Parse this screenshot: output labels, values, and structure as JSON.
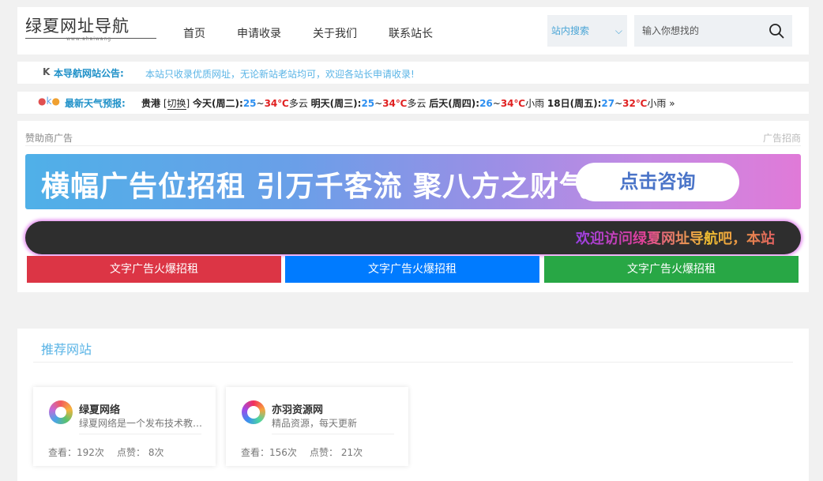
{
  "header": {
    "logo_text": "绿夏网址导航",
    "logo_sub": "www.ahaiwang",
    "nav": [
      "首页",
      "申请收录",
      "关于我们",
      "联系站长"
    ],
    "search_select": "站内搜索",
    "search_placeholder": "输入你想找的"
  },
  "notice": {
    "label": "本导航网站公告:",
    "text": "本站只收录优质网址，无论新站老站均可，欢迎各站长申请收录!"
  },
  "weather": {
    "label": "最新天气预报:",
    "city": "贵港",
    "switch": "切换",
    "days": [
      {
        "day": "今天(周二):",
        "lo": "25",
        "hi": "34℃",
        "cond": "多云"
      },
      {
        "day": "明天(周三):",
        "lo": "25",
        "hi": "34℃",
        "cond": "多云"
      },
      {
        "day": "后天(周四):",
        "lo": "26",
        "hi": "34℃",
        "cond": "小雨"
      },
      {
        "day": "18日(周五):",
        "lo": "27",
        "hi": "32℃",
        "cond": "小雨"
      }
    ],
    "more": "»"
  },
  "ads": {
    "title": "赞助商广告",
    "link": "广告招商",
    "banner_text": "横幅广告位招租 引万千客流 聚八方之财气",
    "banner_button": "点击咨询",
    "marquee": "欢迎访问绿夏网址导航吧，本站",
    "text_ads": [
      "文字广告火爆招租",
      "文字广告火爆招租",
      "文字广告火爆招租"
    ]
  },
  "recommend": {
    "title": "推荐网站",
    "sites": [
      {
        "name": "绿夏网络",
        "desc": "绿夏网络是一个发布技术教程的网站",
        "views": "查看：192次",
        "likes": "点赞： 8次"
      },
      {
        "name": "亦羽资源网",
        "desc": "精品资源，每天更新",
        "views": "查看：156次",
        "likes": "点赞： 21次"
      }
    ]
  }
}
